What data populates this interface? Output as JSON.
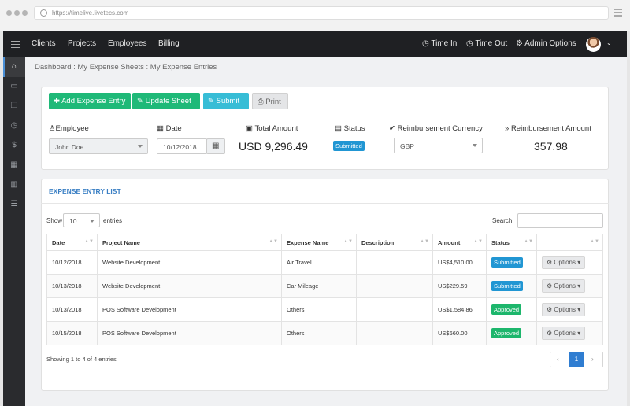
{
  "browser": {
    "url": "https://timelive.livetecs.com"
  },
  "nav": {
    "items": [
      "Clients",
      "Projects",
      "Employees",
      "Billing"
    ],
    "time_in": "Time In",
    "time_out": "Time Out",
    "admin_options": "Admin Options"
  },
  "breadcrumb": "Dashboard : My Expense Sheets : My Expense Entries",
  "toolbar": {
    "add_label": "Add Expense Entry",
    "update_label": "Update Sheet",
    "submit_label": "Submit",
    "print_label": "Print"
  },
  "summary": {
    "employee_label": "Employee",
    "employee_value": "John Doe",
    "date_label": "Date",
    "date_value": "10/12/2018",
    "total_label": "Total Amount",
    "total_value": "USD 9,296.49",
    "status_label": "Status",
    "status_value": "Submitted",
    "currency_label": "Reimbursement Currency",
    "currency_value": "GBP",
    "reimb_label": "Reimbursement Amount",
    "reimb_value": "357.98"
  },
  "list": {
    "title": "EXPENSE ENTRY LIST",
    "show_label": "Show",
    "show_value": "10",
    "entries_label": "entries",
    "search_label": "Search:",
    "columns": [
      "Date",
      "Project Name",
      "Expense Name",
      "Description",
      "Amount",
      "Status",
      ""
    ],
    "rows": [
      {
        "date": "10/12/2018",
        "project": "Website Development",
        "expense": "Air Travel",
        "description": "",
        "amount": "US$4,510.00",
        "status": "Submitted",
        "action": "Options"
      },
      {
        "date": "10/13/2018",
        "project": "Website Development",
        "expense": "Car Mileage",
        "description": "",
        "amount": "US$229.59",
        "status": "Submitted",
        "action": "Options"
      },
      {
        "date": "10/13/2018",
        "project": "POS Software Development",
        "expense": "Others",
        "description": "",
        "amount": "US$1,584.86",
        "status": "Approved",
        "action": "Options"
      },
      {
        "date": "10/15/2018",
        "project": "POS Software Development",
        "expense": "Others",
        "description": "",
        "amount": "US$660.00",
        "status": "Approved",
        "action": "Options"
      }
    ],
    "footer": "Showing 1 to 4 of 4 entries",
    "page": "1"
  },
  "colors": {
    "add": "#1fb978",
    "update": "#1fb978",
    "submit": "#37bdd6",
    "submitted": "#2196d3",
    "approved": "#1db66c"
  }
}
